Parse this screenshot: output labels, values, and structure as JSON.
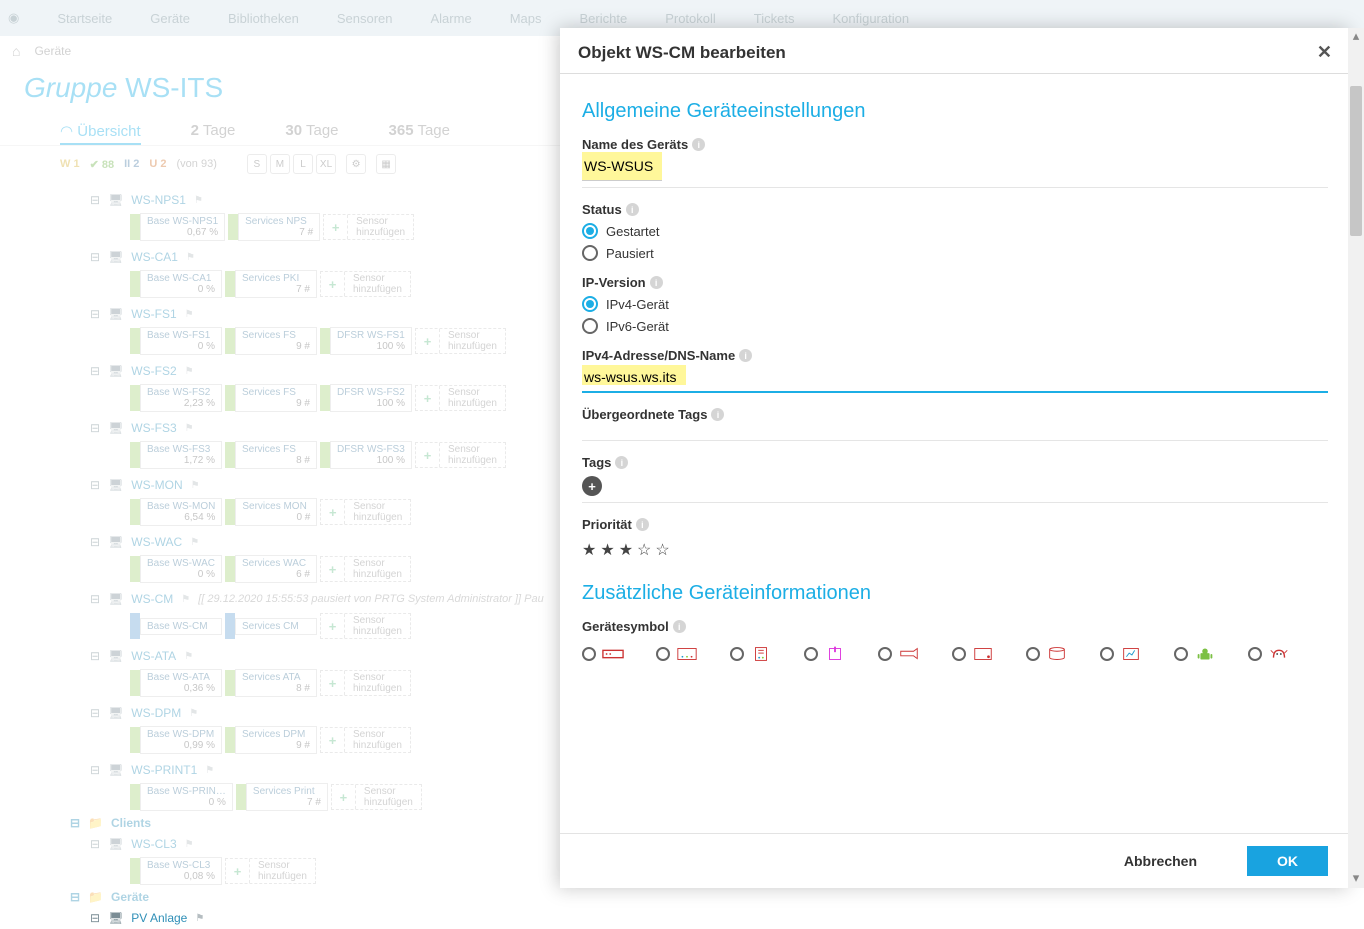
{
  "nav": [
    "Startseite",
    "Geräte",
    "Bibliotheken",
    "Sensoren",
    "Alarme",
    "Maps",
    "Berichte",
    "Protokoll",
    "Tickets",
    "Konfiguration"
  ],
  "crumb_home": "⌂",
  "crumb_dev": "Geräte",
  "group_prefix": "Gruppe",
  "group_name": "WS-ITS",
  "tabs": {
    "overview": "Übersicht",
    "t2": "2",
    "t2s": "Tage",
    "t30": "30",
    "t30s": "Tage",
    "t365": "365",
    "t365s": "Tage"
  },
  "status": {
    "w": "W 1",
    "g": "✔ 88",
    "p": "II 2",
    "u": "U 2",
    "von": "(von 93)",
    "sizes": [
      "S",
      "M",
      "L",
      "XL"
    ]
  },
  "add_sensor_line1": "Sensor",
  "add_sensor_line2": "hinzufügen",
  "devices": [
    {
      "name": "WS-NPS1",
      "sensors": [
        {
          "t": "Base WS-NPS1",
          "v": "0,67 %",
          "st": "ok"
        },
        {
          "t": "Services NPS",
          "v": "7 #",
          "st": "ok"
        }
      ]
    },
    {
      "name": "WS-CA1",
      "sensors": [
        {
          "t": "Base WS-CA1",
          "v": "0 %",
          "st": "ok"
        },
        {
          "t": "Services PKI",
          "v": "7 #",
          "st": "ok"
        }
      ]
    },
    {
      "name": "WS-FS1",
      "sensors": [
        {
          "t": "Base WS-FS1",
          "v": "0 %",
          "st": "ok"
        },
        {
          "t": "Services FS",
          "v": "9 #",
          "st": "ok"
        },
        {
          "t": "DFSR WS-FS1",
          "v": "100 %",
          "st": "ok"
        }
      ]
    },
    {
      "name": "WS-FS2",
      "sensors": [
        {
          "t": "Base WS-FS2",
          "v": "2,23 %",
          "st": "ok"
        },
        {
          "t": "Services FS",
          "v": "9 #",
          "st": "ok"
        },
        {
          "t": "DFSR WS-FS2",
          "v": "100 %",
          "st": "ok"
        }
      ]
    },
    {
      "name": "WS-FS3",
      "sensors": [
        {
          "t": "Base WS-FS3",
          "v": "1,72 %",
          "st": "ok"
        },
        {
          "t": "Services FS",
          "v": "8 #",
          "st": "ok"
        },
        {
          "t": "DFSR WS-FS3",
          "v": "100 %",
          "st": "ok"
        }
      ]
    },
    {
      "name": "WS-MON",
      "sensors": [
        {
          "t": "Base WS-MON",
          "v": "6,54 %",
          "st": "ok"
        },
        {
          "t": "Services MON",
          "v": "0 #",
          "st": "ok"
        }
      ]
    },
    {
      "name": "WS-WAC",
      "sensors": [
        {
          "t": "Base WS-WAC",
          "v": "0 %",
          "st": "ok"
        },
        {
          "t": "Services WAC",
          "v": "6 #",
          "st": "ok"
        }
      ]
    },
    {
      "name": "WS-CM",
      "note": "[[ 29.12.2020 15:55:53 pausiert von PRTG System Administrator ]]  Pau",
      "sensors": [
        {
          "t": "Base WS-CM",
          "v": "",
          "st": "pa"
        },
        {
          "t": "Services CM",
          "v": "",
          "st": "pa"
        }
      ]
    },
    {
      "name": "WS-ATA",
      "sensors": [
        {
          "t": "Base WS-ATA",
          "v": "0,36 %",
          "st": "ok"
        },
        {
          "t": "Services ATA",
          "v": "8 #",
          "st": "ok"
        }
      ]
    },
    {
      "name": "WS-DPM",
      "sensors": [
        {
          "t": "Base WS-DPM",
          "v": "0,99 %",
          "st": "ok"
        },
        {
          "t": "Services DPM",
          "v": "9 #",
          "st": "ok"
        }
      ]
    },
    {
      "name": "WS-PRINT1",
      "sensors": [
        {
          "t": "Base WS-PRIN…",
          "v": "0 %",
          "st": "ok"
        },
        {
          "t": "Services Print",
          "v": "7 #",
          "st": "ok"
        }
      ]
    }
  ],
  "clients_group": "Clients",
  "client_device": "WS-CL3",
  "client_sensor": {
    "t": "Base WS-CL3",
    "v": "0,08 %"
  },
  "devices_group": "Geräte",
  "pv_device": "PV Anlage",
  "modal": {
    "title": "Objekt WS-CM bearbeiten",
    "sec1": "Allgemeine Geräteeinstellungen",
    "name_label": "Name des Geräts",
    "name_value": "WS-WSUS",
    "status_label": "Status",
    "status_started": "Gestartet",
    "status_paused": "Pausiert",
    "ipver_label": "IP-Version",
    "ipver_v4": "IPv4-Gerät",
    "ipver_v6": "IPv6-Gerät",
    "addr_label": "IPv4-Adresse/DNS-Name",
    "addr_value": "ws-wsus.ws.its",
    "parent_tags": "Übergeordnete Tags",
    "tags_label": "Tags",
    "prio_label": "Priorität",
    "sec2": "Zusätzliche Geräteinformationen",
    "icon_label": "Gerätesymbol",
    "cancel": "Abbrechen",
    "ok": "OK"
  }
}
